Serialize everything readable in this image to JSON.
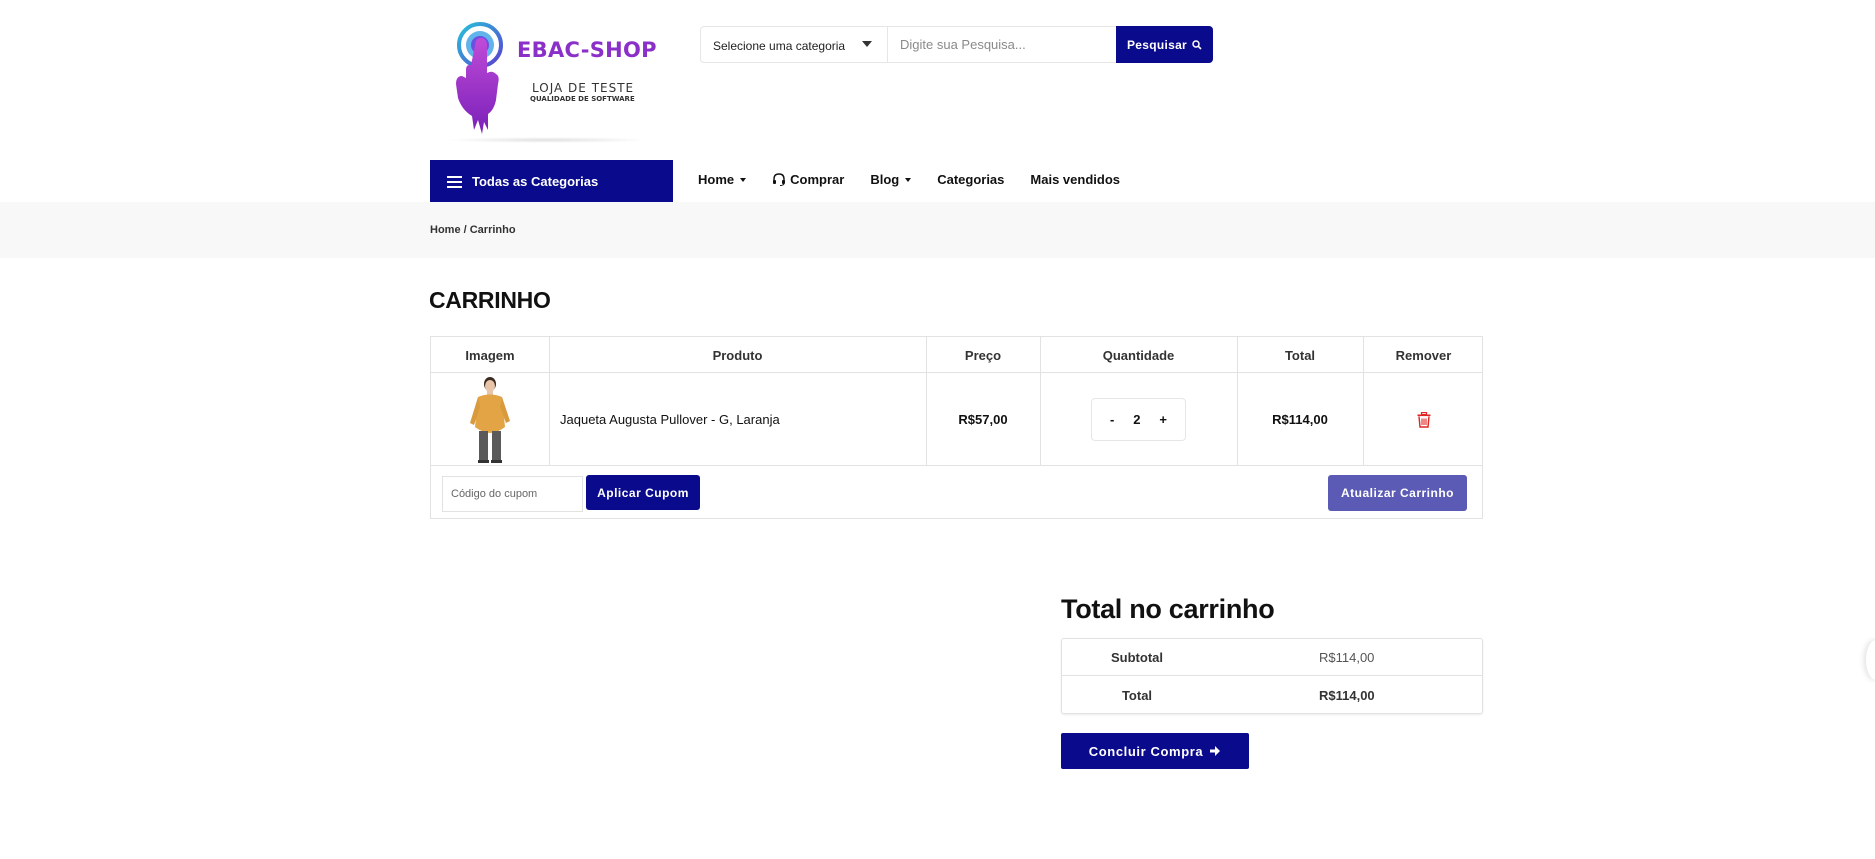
{
  "brand": {
    "name": "EBAC-SHOP",
    "tagline": "LOJA DE TESTE",
    "subtagline": "QUALIDADE DE SOFTWARE",
    "accent": "#8b2fc9"
  },
  "search": {
    "category_label": "Selecione uma categoria",
    "placeholder": "Digite sua Pesquisa...",
    "button_label": "Pesquisar"
  },
  "nav": {
    "all_categories": "Todas as Categorias",
    "items": [
      {
        "label": "Home"
      },
      {
        "label": "Comprar"
      },
      {
        "label": "Blog"
      },
      {
        "label": "Categorias"
      },
      {
        "label": "Mais vendidos"
      }
    ]
  },
  "breadcrumb": {
    "home": "Home",
    "separator": " / ",
    "current": "Carrinho"
  },
  "cart": {
    "title": "CARRINHO",
    "columns": [
      "Imagem",
      "Produto",
      "Preço",
      "Quantidade",
      "Total",
      "Remover"
    ],
    "items": [
      {
        "product": "Jaqueta Augusta Pullover - G, Laranja",
        "price": "R$57,00",
        "quantity": "2",
        "total": "R$114,00"
      }
    ],
    "qty_minus": "-",
    "qty_plus": "+",
    "coupon_placeholder": "Código do cupom",
    "apply_coupon": "Aplicar Cupom",
    "update_cart": "Atualizar Carrinho"
  },
  "totals": {
    "title": "Total no carrinho",
    "subtotal_label": "Subtotal",
    "subtotal_value": "R$114,00",
    "total_label": "Total",
    "total_value": "R$114,00",
    "checkout": "Concluir Compra"
  },
  "colors": {
    "primary": "#0a0a8c",
    "secondary": "#5b5bb5",
    "danger": "#e02424"
  }
}
